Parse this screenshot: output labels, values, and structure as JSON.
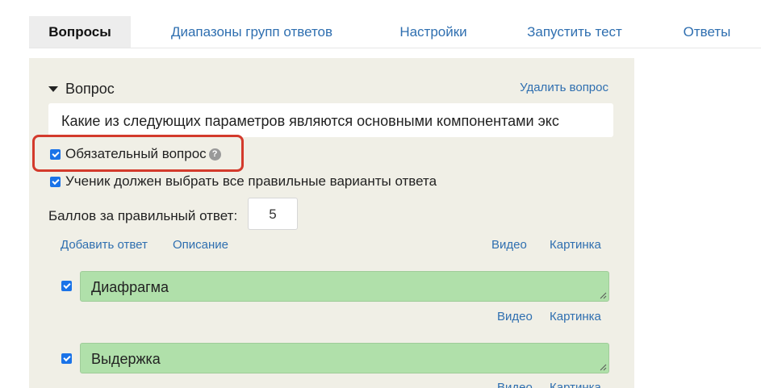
{
  "tabs": [
    {
      "label": "Вопросы",
      "active": true
    },
    {
      "label": "Диапазоны групп ответов",
      "active": false
    },
    {
      "label": "Настройки",
      "active": false
    },
    {
      "label": "Запустить тест",
      "active": false
    },
    {
      "label": "Ответы",
      "active": false
    }
  ],
  "question": {
    "header": "Вопрос",
    "delete_label": "Удалить вопрос",
    "text": "Какие из следующих параметров являются основными компонентами экс",
    "required_label": "Обязательный вопрос",
    "required_checked": true,
    "all_correct_label": "Ученик должен выбрать все правильные варианты ответа",
    "all_correct_checked": true,
    "score_label": "Баллов за правильный ответ:",
    "score_value": "5",
    "add_answer_label": "Добавить ответ",
    "description_label": "Описание",
    "video_label": "Видео",
    "image_label": "Картинка"
  },
  "answers": [
    {
      "text": "Диафрагма",
      "checked": true,
      "video_label": "Видео",
      "image_label": "Картинка"
    },
    {
      "text": "Выдержка",
      "checked": true,
      "video_label": "Видео",
      "image_label": "Картинка"
    }
  ],
  "colors": {
    "accent": "#2f6fb0",
    "answer_bg": "#b0e0aa",
    "panel_bg": "#f0efe6",
    "highlight": "#d33a2c"
  }
}
